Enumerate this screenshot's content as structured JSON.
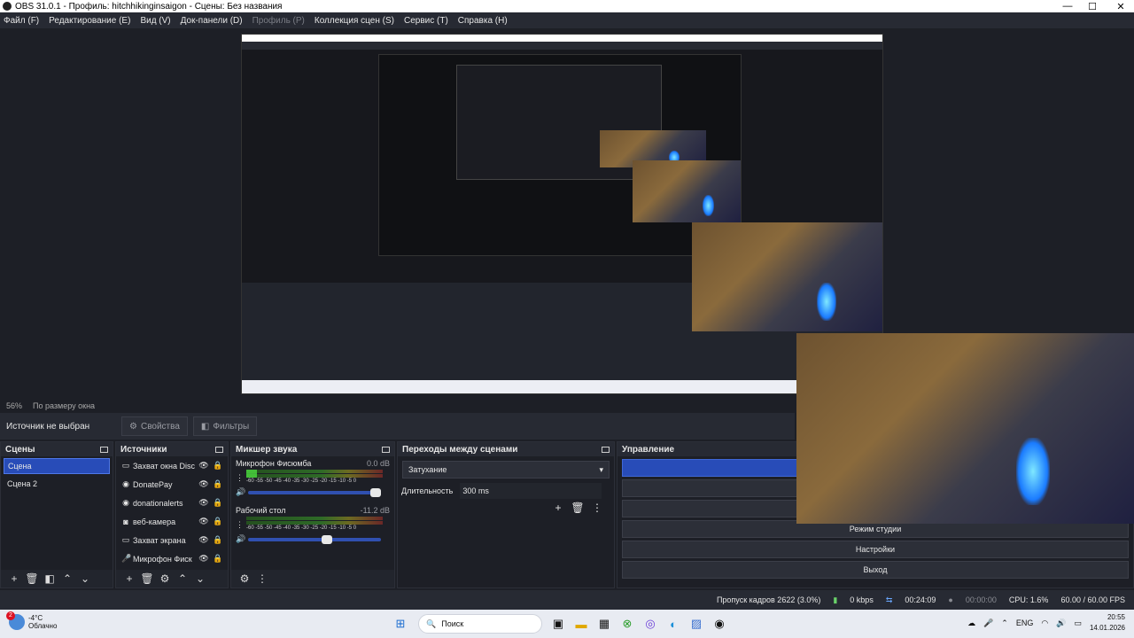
{
  "window": {
    "title": "OBS 31.0.1 - Профиль: hitchhikinginsaigon - Сцены: Без названия",
    "min": "—",
    "max": "☐",
    "close": "✕"
  },
  "menu": {
    "file": "Файл (F)",
    "edit": "Редактирование (E)",
    "view": "Вид (V)",
    "docks": "Док-панели (D)",
    "profile": "Профиль (P)",
    "collection": "Коллекция сцен (S)",
    "tools": "Сервис (T)",
    "help": "Справка (H)"
  },
  "zoom": {
    "percent": "56%",
    "mode": "По размеру окна"
  },
  "context": {
    "no_source": "Источник не выбран",
    "properties": "Свойства",
    "filters": "Фильтры"
  },
  "scenes": {
    "title": "Сцены",
    "items": [
      {
        "label": "Сцена"
      },
      {
        "label": "Сцена 2"
      }
    ]
  },
  "sources": {
    "title": "Источники",
    "items": [
      {
        "label": "Захват окна Disc",
        "icon": "▭"
      },
      {
        "label": "DonatePay",
        "icon": "◉"
      },
      {
        "label": "donationalerts",
        "icon": "◉"
      },
      {
        "label": "веб-камера",
        "icon": "◙"
      },
      {
        "label": "Захват экрана",
        "icon": "▭"
      },
      {
        "label": "Микрофон Фиск",
        "icon": "🎤"
      }
    ]
  },
  "mixer": {
    "title": "Микшер звука",
    "ticks": "-60 -55 -50 -45 -40 -35 -30 -25 -20 -15 -10 -5 0",
    "channels": [
      {
        "name": "Микрофон Фисюмба",
        "db": "0.0 dB",
        "level": 0.08,
        "volume": 1.0
      },
      {
        "name": "Рабочий стол",
        "db": "-11.2 dB",
        "level": 0.0,
        "volume": 0.63
      }
    ]
  },
  "transitions": {
    "title": "Переходы между сценами",
    "selected": "Затухание",
    "duration_label": "Длительность",
    "duration_value": "300 ms"
  },
  "controls": {
    "title": "Управление",
    "studio": "Режим студии",
    "settings": "Настройки",
    "exit": "Выход"
  },
  "status": {
    "dropped": "Пропуск кадров 2622 (3.0%)",
    "kbps": "0 kbps",
    "stream_time": "00:24:09",
    "rec_time": "00:00:00",
    "cpu": "CPU: 1.6%",
    "fps": "60.00 / 60.00 FPS"
  },
  "taskbar": {
    "badge": "2",
    "temp": "-4°C",
    "weather": "Облачно",
    "search": "Поиск",
    "lang": "ENG",
    "time": "20:55",
    "date": "14.01.2026"
  }
}
